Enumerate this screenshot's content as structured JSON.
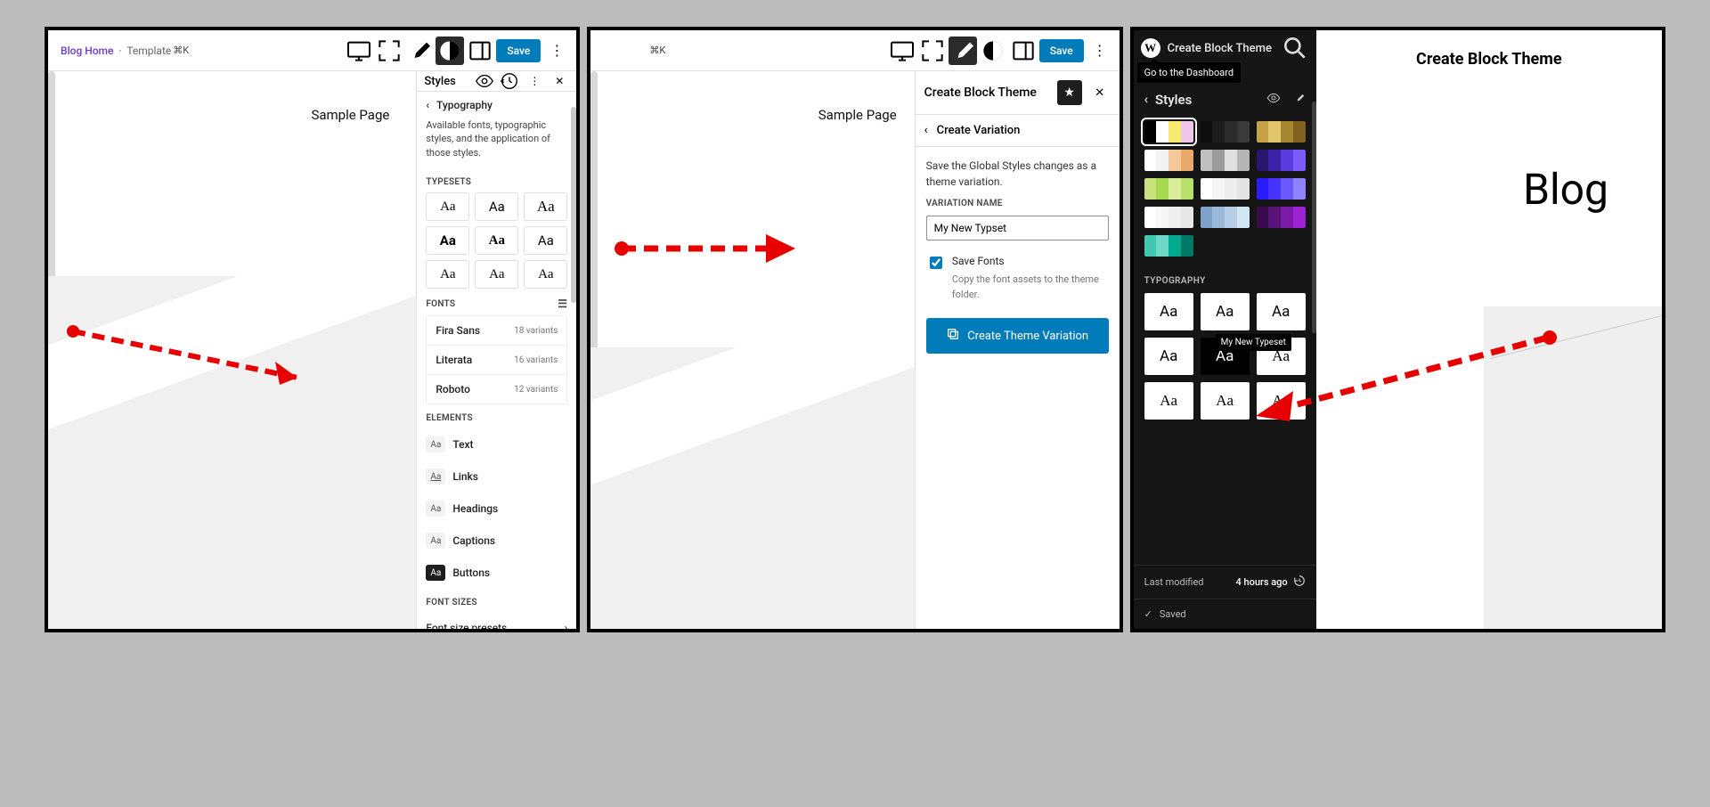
{
  "frame1": {
    "breadcrumb": {
      "home": "Blog Home",
      "sep": "·",
      "tmpl": "Template"
    },
    "kbd": "⌘K",
    "save_label": "Save",
    "canvas_tab": "Sample Page",
    "side": {
      "title": "Styles",
      "nav_title": "Typography",
      "description": "Available fonts, typographic styles, and the application of those styles.",
      "typesets_label": "Typesets",
      "typesets": [
        {
          "label": "Aa",
          "cls": "serif"
        },
        {
          "label": "Aa",
          "cls": ""
        },
        {
          "label": "Aa",
          "cls": "script"
        },
        {
          "label": "Aa",
          "cls": "bold"
        },
        {
          "label": "Aa",
          "cls": "serif bold"
        },
        {
          "label": "Aa",
          "cls": ""
        },
        {
          "label": "Aa",
          "cls": "serif"
        },
        {
          "label": "Aa",
          "cls": "serif"
        },
        {
          "label": "Aa",
          "cls": "serif"
        }
      ],
      "fonts_label": "Fonts",
      "fonts": [
        {
          "name": "Fira Sans",
          "meta": "18 variants"
        },
        {
          "name": "Literata",
          "meta": "16 variants"
        },
        {
          "name": "Roboto",
          "meta": "12 variants"
        }
      ],
      "elements_label": "Elements",
      "elements": [
        {
          "label": "Text",
          "dark": false
        },
        {
          "label": "Links",
          "dark": false,
          "underline": true
        },
        {
          "label": "Headings",
          "dark": false
        },
        {
          "label": "Captions",
          "dark": false
        },
        {
          "label": "Buttons",
          "dark": true
        }
      ],
      "sizes_label": "Font Sizes",
      "preset_label": "Font size presets"
    }
  },
  "frame2": {
    "kbd": "⌘K",
    "save_label": "Save",
    "canvas_tab": "Sample Page",
    "panel_title": "Create Block Theme",
    "nav_title": "Create Variation",
    "description": "Save the Global Styles changes as a theme variation.",
    "variation_label": "Variation Name",
    "variation_value": "My New Typset",
    "save_fonts_label": "Save Fonts",
    "save_fonts_desc": "Copy the font assets to the theme folder.",
    "create_btn": "Create Theme Variation"
  },
  "frame3": {
    "header_title": "Create Block Theme",
    "dashboard_tooltip": "Go to the Dashboard",
    "styles_title": "Styles",
    "swatches": [
      [
        "#000",
        "#fff",
        "#f7e96f",
        "#f1c6ea"
      ],
      [
        "#0d0d0d",
        "#1d1d1d",
        "#2b2b2b",
        "#3a3a3a"
      ],
      [
        "#c7a145",
        "#e0c56b",
        "#a7862f",
        "#806120"
      ],
      [
        "#fff",
        "#f3f3f3",
        "#f4c89a",
        "#e9a869"
      ],
      [
        "#c0c0c0",
        "#9a9a9a",
        "#e0e0e0",
        "#b5b5b5"
      ],
      [
        "#281670",
        "#3b22a8",
        "#5a3be0",
        "#7a5bff"
      ],
      [
        "#c7e27a",
        "#a6d94f",
        "#d9ee9a",
        "#b8e06a"
      ],
      [
        "#fff",
        "#f6f6f6",
        "#ededed",
        "#e4e4e4"
      ],
      [
        "#2b1bff",
        "#4733ff",
        "#6a59ff",
        "#8f82ff"
      ],
      [
        "#fff",
        "#f7f7f7",
        "#efefef",
        "#e7e7e7"
      ],
      [
        "#7fa3c8",
        "#9bb9d8",
        "#b6cfe6",
        "#d2e5f3"
      ],
      [
        "#3a0a4f",
        "#581278",
        "#7a1aa6",
        "#9d22d4"
      ],
      [
        "#3ec9b0",
        "#6ed9c6",
        "#00a98f",
        "#007a66"
      ]
    ],
    "typography_label": "Typography",
    "typography": [
      {
        "label": "Aa",
        "cls": ""
      },
      {
        "label": "Aa",
        "cls": ""
      },
      {
        "label": "Aa",
        "cls": ""
      },
      {
        "label": "Aa",
        "cls": ""
      },
      {
        "label": "Aa",
        "cls": "black"
      },
      {
        "label": "Aa",
        "cls": "serif"
      },
      {
        "label": "Aa",
        "cls": "serif"
      },
      {
        "label": "Aa",
        "cls": "serif"
      },
      {
        "label": "Aa",
        "cls": "serif"
      }
    ],
    "tooltip": "My New Typeset",
    "last_modified_label": "Last modified",
    "last_modified_value": "4 hours ago",
    "saved_label": "Saved",
    "canvas_title": "Create Block Theme",
    "canvas_blog": "Blog"
  }
}
